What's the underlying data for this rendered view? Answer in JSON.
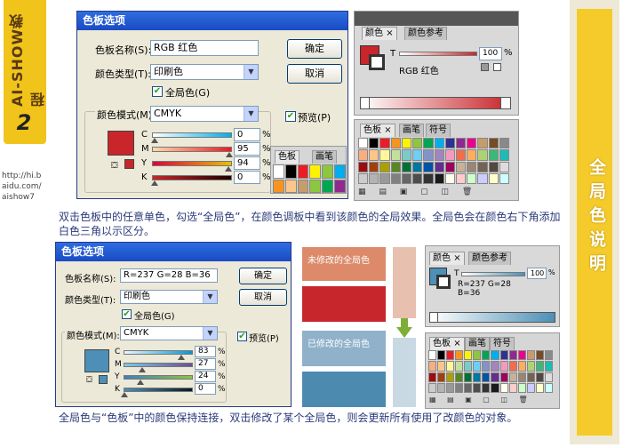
{
  "left_tab": {
    "text": "AI-SHOW教程",
    "number": "2"
  },
  "url": [
    "http://hi.b",
    "aidu.com/",
    "aishow7"
  ],
  "right_banner": {
    "text": "全局色说明"
  },
  "dialog1": {
    "title": "色板选项",
    "name_label": "色板名称(S):",
    "name_value": "RGB 红色",
    "type_label": "颜色类型(T):",
    "type_value": "印刷色",
    "global_label": "全局色(G)",
    "mode_label": "颜色模式(M):",
    "mode_value": "CMYK",
    "ok": "确定",
    "cancel": "取消",
    "preview": "预览(P)",
    "sliders": [
      {
        "ch": "C",
        "val": "0"
      },
      {
        "ch": "M",
        "val": "95"
      },
      {
        "ch": "Y",
        "val": "94"
      },
      {
        "ch": "K",
        "val": "0"
      }
    ],
    "pct": "%",
    "swatch_color": "#c8262a"
  },
  "popup_tabs": {
    "tab1": "色板",
    "tab2": "画笔"
  },
  "color_panel1": {
    "tab1": "颜色",
    "tab2": "颜色参考",
    "t_label": "T",
    "t_value": "100",
    "pct": "%",
    "swatch_name": "RGB 红色"
  },
  "swatch_panel1": {
    "tab1": "色板",
    "tab2": "画笔",
    "tab3": "符号"
  },
  "caption1": "双击色板中的任意单色，勾选“全局色”，在颜色调板中看到该颜色的全局效果。全局色会在颜色右下角添加白色三角以示区分。",
  "dialog2": {
    "title": "色板选项",
    "name_label": "色板名称(S):",
    "name_value": "R=237 G=28 B=36",
    "type_label": "颜色类型(T):",
    "type_value": "印刷色",
    "global_label": "全局色(G)",
    "mode_label": "颜色模式(M):",
    "mode_value": "CMYK",
    "ok": "确定",
    "cancel": "取消",
    "preview": "预览(P)",
    "sliders": [
      {
        "ch": "C",
        "val": "83"
      },
      {
        "ch": "M",
        "val": "27"
      },
      {
        "ch": "Y",
        "val": "24"
      },
      {
        "ch": "K",
        "val": "0"
      }
    ],
    "pct": "%",
    "swatch_color": "#4d8fb6"
  },
  "compare": {
    "before_label": "未修改的全局色",
    "after_label": "已修改的全局色",
    "before_color": "#dc8a6a",
    "before_color2": "#c7262c",
    "after_color": "#8fb1c9",
    "after_color2": "#4c8ab0"
  },
  "color_panel2": {
    "tab1": "颜色",
    "tab2": "颜色参考",
    "t_label": "T",
    "t_value": "100",
    "pct": "%",
    "swatch_name": "R=237 G=28",
    "swatch_name2": "B=36"
  },
  "swatch_panel2": {
    "tab1": "色板",
    "tab2": "画笔",
    "tab3": "符号"
  },
  "caption2": "全局色与“色板”中的颜色保持连接，双击修改了某个全局色，则会更新所有使用了改颜色的对象。"
}
